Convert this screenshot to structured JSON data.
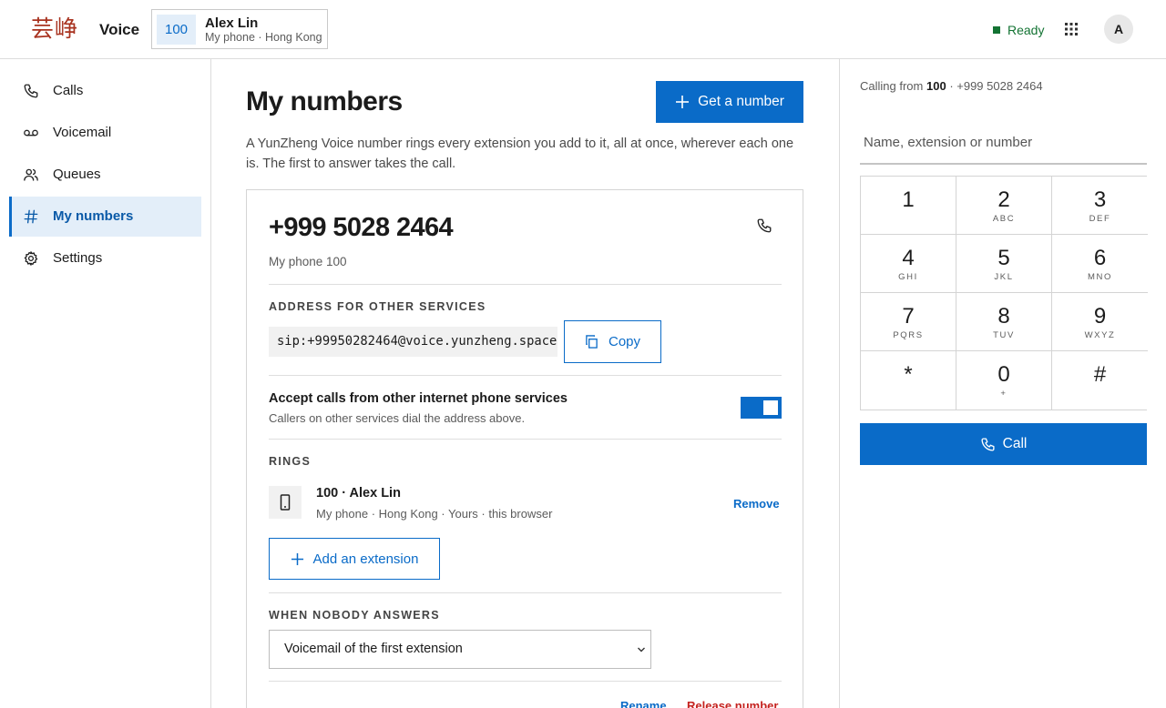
{
  "header": {
    "logo_text": "芸峥",
    "app_name": "Voice",
    "user": {
      "extension": "100",
      "name": "Alex Lin",
      "subtitle": "My phone · Hong Kong"
    },
    "status": "Ready",
    "avatar_initial": "A",
    "status_color": "#137333"
  },
  "sidebar": {
    "items": [
      {
        "label": "Calls",
        "icon": "phone-icon"
      },
      {
        "label": "Voicemail",
        "icon": "voicemail-icon"
      },
      {
        "label": "Queues",
        "icon": "people-icon"
      },
      {
        "label": "My numbers",
        "icon": "hash-icon",
        "active": true
      },
      {
        "label": "Settings",
        "icon": "gear-icon"
      }
    ]
  },
  "main": {
    "title": "My numbers",
    "get_number_label": "Get a number",
    "intro": "A YunZheng Voice number rings every extension you add to it, all at once, wherever each one is. The first to answer takes the call.",
    "card": {
      "phone_number": "+999 5028 2464",
      "subtitle": "My phone 100",
      "address_label": "ADDRESS FOR OTHER SERVICES",
      "sip_address": "sip:+99950282464@voice.yunzheng.space",
      "copy_label": "Copy",
      "accept_title": "Accept calls from other internet phone services",
      "accept_subtitle": "Callers on other services dial the address above.",
      "accept_enabled": true,
      "rings_label": "RINGS",
      "ring": {
        "title": "100 · Alex Lin",
        "subtitle": "My phone · Hong Kong · Yours · this browser",
        "remove_label": "Remove"
      },
      "add_extension_label": "Add an extension",
      "nobody_label": "WHEN NOBODY ANSWERS",
      "nobody_selected": "Voicemail of the first extension",
      "rename_label": "Rename",
      "release_label": "Release number"
    }
  },
  "dialer": {
    "calling_from_prefix": "Calling from",
    "calling_from_ext": "100",
    "calling_from_number": "· +999 5028 2464",
    "input_placeholder": "Name, extension or number",
    "keys": [
      {
        "digit": "1",
        "letters": ""
      },
      {
        "digit": "2",
        "letters": "ABC"
      },
      {
        "digit": "3",
        "letters": "DEF"
      },
      {
        "digit": "4",
        "letters": "GHI"
      },
      {
        "digit": "5",
        "letters": "JKL"
      },
      {
        "digit": "6",
        "letters": "MNO"
      },
      {
        "digit": "7",
        "letters": "PQRS"
      },
      {
        "digit": "8",
        "letters": "TUV"
      },
      {
        "digit": "9",
        "letters": "WXYZ"
      },
      {
        "digit": "*",
        "letters": ""
      },
      {
        "digit": "0",
        "letters": "+"
      },
      {
        "digit": "#",
        "letters": ""
      }
    ],
    "call_label": "Call"
  },
  "colors": {
    "accent": "#0a6bc8",
    "danger": "#c5221f",
    "active_bg": "#e3eef9"
  }
}
